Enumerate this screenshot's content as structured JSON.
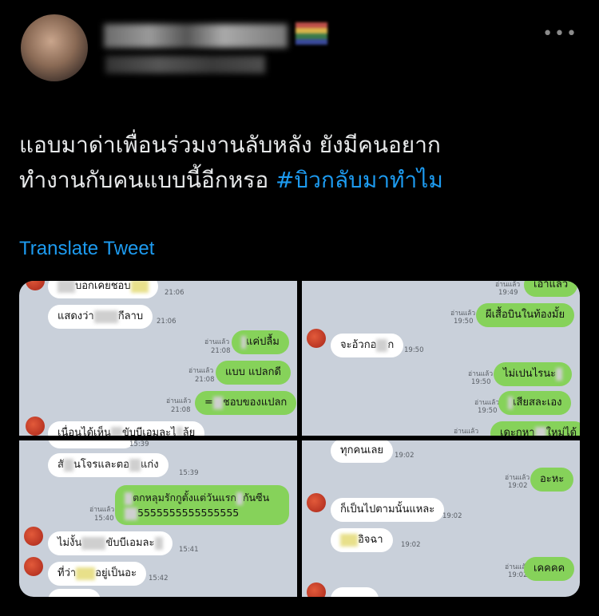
{
  "tweet": {
    "line1": "แอบมาด่าเพื่อนร่วมงานลับหลัง ยังมีคนอยาก",
    "line2": "ทำงานกับคนแบบนี้อีกหรอ ",
    "hashtag": "#บิวกลับมาทำไม",
    "translate": "Translate Tweet",
    "more": "•••"
  },
  "colors": {
    "background": "#000000",
    "text": "#e7e9ea",
    "link": "#1d9bf0",
    "chat_bg": "#c9d0da",
    "bubble_out": "#86d25a",
    "bubble_in": "#ffffff"
  },
  "panel1": {
    "m1": "บอกเคยชอบ",
    "t1": "21:06",
    "m2a": "แสดงว่า",
    "m2b": "กีลาบ",
    "t2": "21:06",
    "r3": "อ่านแล้ว",
    "t3": "21:08",
    "m3": "แค่ปลื้ม",
    "r4": "อ่านแล้ว",
    "t4": "21:08",
    "m4": "แบบ แปลกดี",
    "r5": "อ่านแล้ว",
    "t5": "21:08",
    "m5a": "=",
    "m5b": "ชอบของแปลก",
    "m6a": "เนื่อนได้เห็น",
    "m6b": "ขับบีเอมละไ",
    "m6c": "ล้ย"
  },
  "panel2": {
    "r1": "อ่านแล้ว",
    "t1": "19:49",
    "m1": "เอาแล้ว",
    "r2": "อ่านแล้ว",
    "t2": "19:50",
    "m2": "ผีเสื้อบินในท้องมั้ย",
    "m3a": "จะอ้วกอ",
    "m3b": "ก",
    "t3": "19:50",
    "r4": "อ่านแล้ว",
    "t4": "19:50",
    "m4": "ไม่เปนไรนะ",
    "r5": "อ่านแล้ว",
    "t5": "19:50",
    "m5": "เสียสละเอง",
    "r6": "อ่านแล้ว",
    "m6a": "เดะกหา",
    "m6b": "ใหม่ได้"
  },
  "panel3": {
    "t0": "15:39",
    "m1a": "สั",
    "m1b": "นโจรและตอ",
    "m1c": "แก่ง",
    "t1": "15:39",
    "r2": "อ่านแล้ว",
    "t2": "15:40",
    "m2a": "ตกหลุมรักกูตั้งแต่วันแรก",
    "m2b": "กันซีน",
    "m2c": "5555555555555555",
    "m3a": "ไม่งั้น",
    "m3b": "ขับบีเอมละ",
    "t3": "15:41",
    "m4a": "ที่ว่า",
    "m4b": "อยู่เป็นอะ",
    "t4": "15:42"
  },
  "panel4": {
    "m1": "ทุกคนเลย",
    "t1": "19:02",
    "r2": "อ่านแล้ว",
    "t2": "19:02",
    "m2": "อะหะ",
    "m3": "ก็เป็นไปตามนั้นแหละ",
    "t3": "19:02",
    "m4": "อิจฉา",
    "t4": "19:02",
    "r5": "อ่านแล้ว",
    "t5": "19:02",
    "m5": "เคคคค"
  }
}
